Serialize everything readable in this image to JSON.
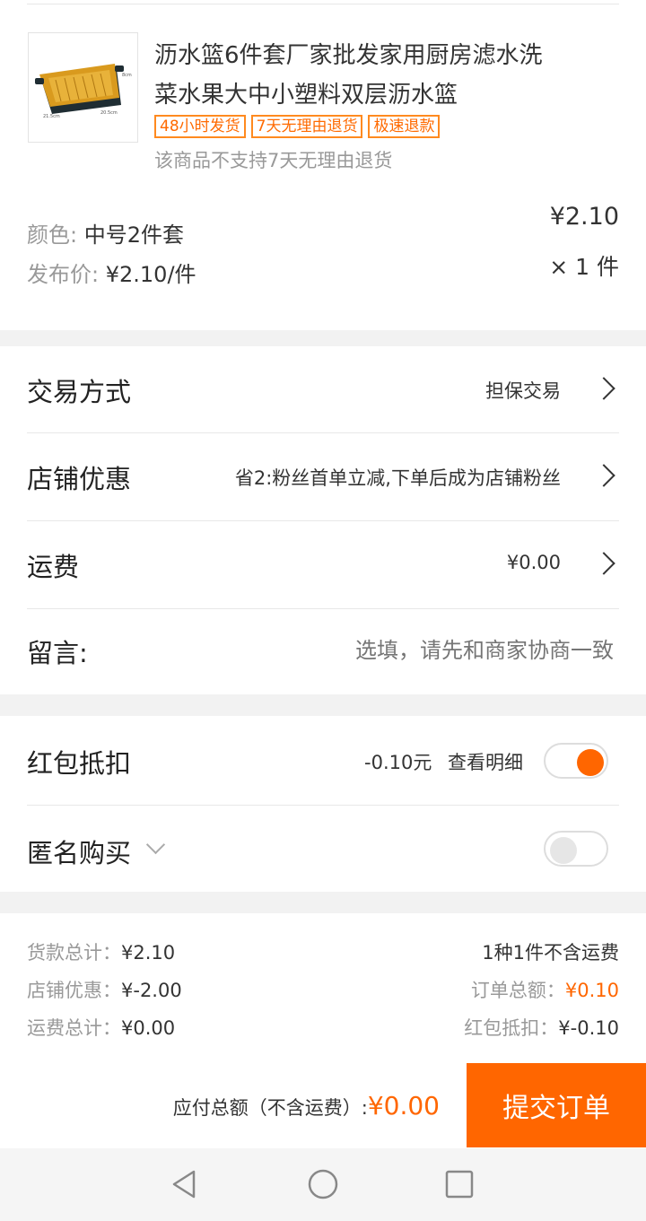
{
  "product": {
    "title_line1": "沥水篮6件套厂家批发家用厨房滤水洗",
    "title_line2": "菜水果大中小塑料双层沥水篮",
    "tags": [
      "48小时发货",
      "7天无理由退货",
      "极速退款"
    ],
    "return_note": "该商品不支持7天无理由退货",
    "thumb_dims": [
      "8cm",
      "21.5cm",
      "20.5cm"
    ],
    "color_label": "颜色:",
    "color_value": "中号2件套",
    "price_label": "发布价:",
    "price_value": "¥2.10/件",
    "unit_price": "¥2.10",
    "quantity": "× 1 件"
  },
  "rows": {
    "trade_label": "交易方式",
    "trade_value": "担保交易",
    "shop_discount_label": "店铺优惠",
    "shop_discount_value": "省2:粉丝首单立减,下单后成为店铺粉丝",
    "shipping_label": "运费",
    "shipping_value": "¥0.00",
    "message_label": "留言:",
    "message_placeholder": "选填，请先和商家协商一致"
  },
  "options": {
    "redpacket_label": "红包抵扣",
    "redpacket_amount": "-0.10元",
    "redpacket_detail": "查看明细",
    "redpacket_on": true,
    "anonymous_label": "匿名购买",
    "anonymous_on": false
  },
  "summary": {
    "goods_total_label": "货款总计：",
    "goods_total": "¥2.10",
    "shop_discount_label": "店铺优惠：",
    "shop_discount": "¥-2.00",
    "shipping_total_label": "运费总计：",
    "shipping_total": "¥0.00",
    "count_text": "1种1件不含运费",
    "order_total_label": "订单总额：",
    "order_total": "¥0.10",
    "redpacket_label": "红包抵扣：",
    "redpacket": "¥-0.10"
  },
  "footer": {
    "payable_label": "应付总额（不含运费）:",
    "payable_value": "¥0.00",
    "submit_label": "提交订单"
  },
  "colors": {
    "accent": "#ff6600",
    "submit_bg": "#ff6600"
  },
  "navbar": {
    "icons": [
      "back-triangle-icon",
      "home-circle-icon",
      "recents-square-icon"
    ]
  }
}
